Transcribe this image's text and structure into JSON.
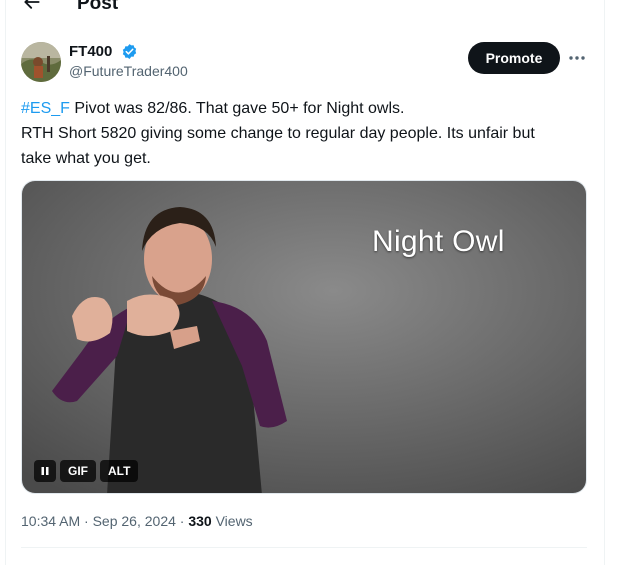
{
  "header": {
    "title": "Post",
    "back_icon": "arrow-left-icon"
  },
  "author": {
    "display_name": "FT400",
    "handle": "@FutureTrader400",
    "verified": true,
    "verified_color": "#1d9bf0"
  },
  "actions": {
    "promote_label": "Promote",
    "more_icon": "more-horizontal-icon"
  },
  "tweet": {
    "hashtag": "#ES_F",
    "line1_rest": " Pivot was 82/86. That gave 50+ for Night owls.",
    "line2": "RTH Short 5820 giving some change to regular day people. Its unfair but",
    "line3": "take what you get."
  },
  "media": {
    "caption": "Night Owl",
    "pause_icon": "pause-icon",
    "gif_label": "GIF",
    "alt_label": "ALT"
  },
  "meta": {
    "timestamp": "10:34 AM · Sep 26, 2024 · ",
    "views_count": "330",
    "views_label": " Views"
  },
  "colors": {
    "accent": "#1d9bf0",
    "text_primary": "#0f1419",
    "text_secondary": "#536471"
  }
}
